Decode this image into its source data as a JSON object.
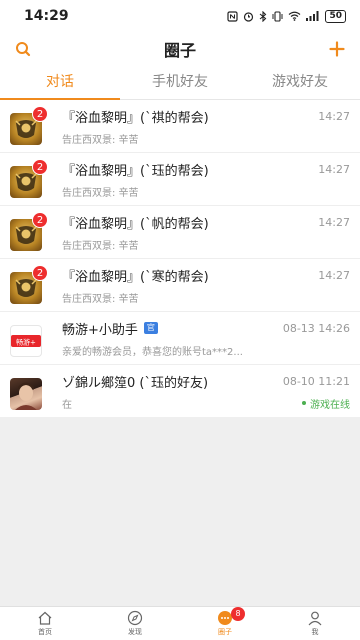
{
  "status_bar": {
    "time": "14:29",
    "battery": "50"
  },
  "header": {
    "title": "圈子",
    "search_icon": "search-icon",
    "add_icon": "plus-icon"
  },
  "colors": {
    "accent": "#f08a1c",
    "badge": "#ee2e2e",
    "online": "#4caf50",
    "official": "#3b7fe0"
  },
  "tabs": [
    {
      "label": "对话",
      "active": true
    },
    {
      "label": "手机好友",
      "active": false
    },
    {
      "label": "游戏好友",
      "active": false
    }
  ],
  "conversations": [
    {
      "name": "『浴血黎明』(`祺的帮会)",
      "time": "14:27",
      "sub": "告庄西双景: 辛苦",
      "badge": "2",
      "avatar": "guild-icon"
    },
    {
      "name": "『浴血黎明』(`珏的帮会)",
      "time": "14:27",
      "sub": "告庄西双景: 辛苦",
      "badge": "2",
      "avatar": "guild-icon"
    },
    {
      "name": "『浴血黎明』(`帆的帮会)",
      "time": "14:27",
      "sub": "告庄西双景: 辛苦",
      "badge": "2",
      "avatar": "guild-icon"
    },
    {
      "name": "『浴血黎明』(`寒的帮会)",
      "time": "14:27",
      "sub": "告庄西双景: 辛苦",
      "badge": "2",
      "avatar": "guild-icon"
    },
    {
      "name": "畅游+小助手",
      "tag": "官",
      "time": "08-13 14:26",
      "sub": "亲爱的畅游会员，恭喜您的账号ta***2...",
      "avatar": "changyou-logo",
      "avatar_text": "畅游+"
    },
    {
      "name": "ゾ錦ル鄉篞0 (`珏的好友)",
      "time": "08-10 11:21",
      "sub": "在",
      "status": "游戏在线",
      "avatar": "user-avatar"
    }
  ],
  "bottom_nav": [
    {
      "label": "首页",
      "icon": "home-icon",
      "active": false
    },
    {
      "label": "发现",
      "icon": "compass-icon",
      "active": false
    },
    {
      "label": "圈子",
      "icon": "chat-icon",
      "active": true,
      "badge": "8"
    },
    {
      "label": "我",
      "icon": "user-icon",
      "active": false
    }
  ]
}
